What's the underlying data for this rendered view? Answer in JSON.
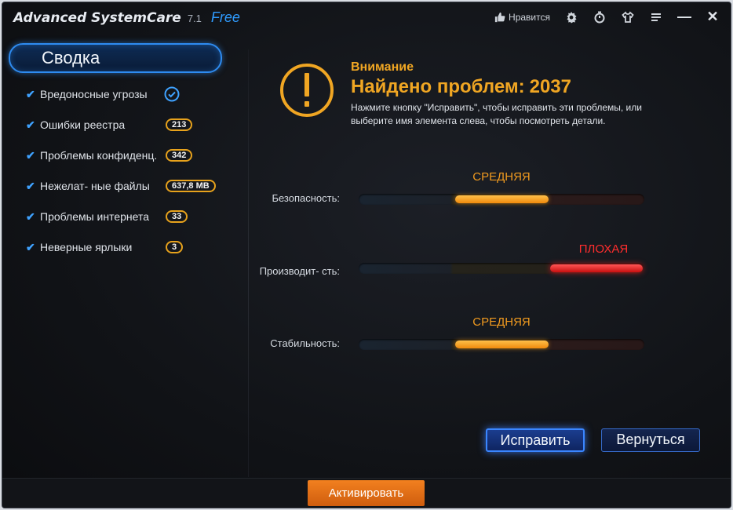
{
  "title": {
    "app_name": "Advanced SystemCare",
    "version": "7.1",
    "edition": "Free",
    "like_label": "Нравится"
  },
  "sidebar": {
    "summary_label": "Сводка",
    "items": [
      {
        "label": "Вредоносные угрозы",
        "badge": ""
      },
      {
        "label": "Ошибки реестра",
        "badge": "213"
      },
      {
        "label": "Проблемы конфиденц.",
        "badge": "342"
      },
      {
        "label": "Нежелат- ные файлы",
        "badge": "637,8 MB"
      },
      {
        "label": "Проблемы интернета",
        "badge": "33"
      },
      {
        "label": "Неверные ярлыки",
        "badge": "3"
      }
    ]
  },
  "warning": {
    "title": "Внимание",
    "count_label": "Найдено проблем:",
    "count": "2037",
    "description": "Нажмите кнопку \"Исправить\", чтобы исправить эти проблемы, или выберите имя элемента слева, чтобы посмотреть детали."
  },
  "metrics": [
    {
      "label": "Безопасность:",
      "status": "СРЕДНЯЯ",
      "level": "medium"
    },
    {
      "label": "Производит- сть:",
      "status": "ПЛОХАЯ",
      "level": "bad"
    },
    {
      "label": "Стабильность:",
      "status": "СРЕДНЯЯ",
      "level": "medium"
    }
  ],
  "buttons": {
    "fix": "Исправить",
    "back": "Вернуться",
    "activate": "Активировать"
  },
  "colors": {
    "accent_blue": "#2e8bf0",
    "warning_orange": "#f0a623",
    "status_bad": "#ff2d2d",
    "activate_orange": "#e8701a"
  }
}
